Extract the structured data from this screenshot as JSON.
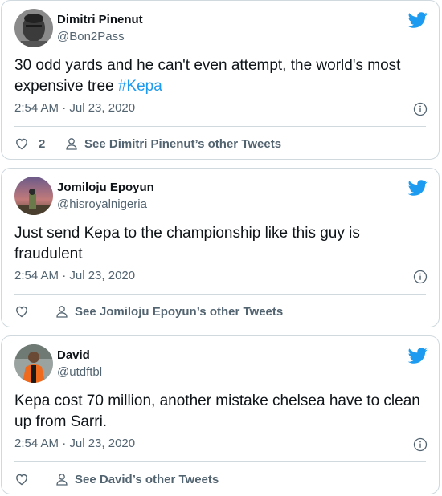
{
  "colors": {
    "twitter_blue": "#1d9bf0",
    "secondary_text": "#536471",
    "border": "#cfd9de"
  },
  "tweets": [
    {
      "name": "Dimitri Pinenut",
      "handle": "@Bon2Pass",
      "text_before_tag": "30 odd yards and he can't even attempt, the world's most expensive tree ",
      "hashtag": "#Kepa",
      "timestamp": "2:54 AM · Jul 23, 2020",
      "like_count": "2",
      "see_other": "See Dimitri Pinenut’s other Tweets"
    },
    {
      "name": "Jomiloju Epoyun",
      "handle": "@hisroyalnigeria",
      "text": "Just send Kepa to the championship like this guy is fraudulent",
      "timestamp": "2:54 AM · Jul 23, 2020",
      "see_other": "See Jomiloju Epoyun’s other Tweets"
    },
    {
      "name": "David",
      "handle": "@utdftbl",
      "text": "Kepa cost 70 million, another mistake chelsea have to clean up from Sarri.",
      "timestamp": "2:54 AM · Jul 23, 2020",
      "see_other": "See David’s other Tweets"
    }
  ]
}
